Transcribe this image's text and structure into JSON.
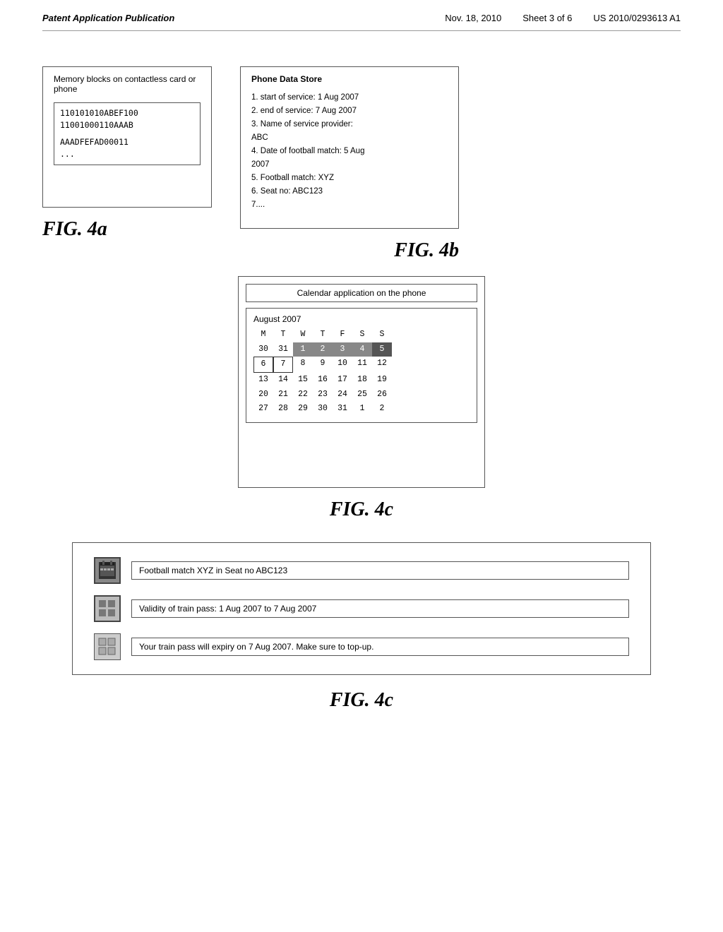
{
  "header": {
    "pub_type": "Patent Application Publication",
    "date": "Nov. 18, 2010",
    "sheet": "Sheet 3",
    "of_pages": "of 6",
    "patent_number": "US 2010/0293613 A1"
  },
  "fig4a": {
    "label": "FIG. 4a",
    "box_title": "Memory blocks on contactless card or phone",
    "memory_lines": [
      "110101010ABEF100",
      "11001000110AAAB",
      "",
      "AAADFEFAD00011",
      "..."
    ]
  },
  "fig4b": {
    "label": "FIG. 4b",
    "box_title": "Phone Data Store",
    "items": [
      "1. start of service: 1 Aug 2007",
      "2. end of service: 7 Aug 2007",
      "3. Name of service provider: ABC",
      "4. Date of football match: 5 Aug 2007",
      "5. Football match: XYZ",
      "6. Seat no: ABC123",
      "7...."
    ]
  },
  "fig4c_calendar": {
    "label": "FIG. 4c",
    "header_text": "Calendar application on the phone",
    "month_title": "August 2007",
    "day_headers": [
      "M",
      "T",
      "W",
      "T",
      "F",
      "S",
      "S"
    ],
    "weeks": [
      [
        "30",
        "31",
        "1",
        "2",
        "3",
        "4",
        "5"
      ],
      [
        "6",
        "7",
        "8",
        "9",
        "10",
        "11",
        "12"
      ],
      [
        "13",
        "14",
        "15",
        "16",
        "17",
        "18",
        "19"
      ],
      [
        "20",
        "21",
        "22",
        "23",
        "24",
        "25",
        "26"
      ],
      [
        "27",
        "28",
        "29",
        "30",
        "31",
        "1",
        "2"
      ]
    ],
    "highlighted_cells": [
      "1",
      "2",
      "3",
      "4",
      "5",
      "6",
      "7"
    ],
    "week1_highlight": [
      2,
      3,
      4,
      5,
      6
    ],
    "week2_highlight": [
      0,
      1
    ]
  },
  "fig4c_notifications": {
    "label": "FIG. 4c",
    "notifications": [
      {
        "id": "notif-1",
        "icon_type": "calendar-dark",
        "text": "Football match XYZ in Seat no ABC123"
      },
      {
        "id": "notif-2",
        "icon_type": "grid-medium",
        "text": "Validity of train pass: 1 Aug 2007 to 7 Aug 2007"
      },
      {
        "id": "notif-3",
        "icon_type": "grid-light",
        "text": "Your train pass will expiry on 7 Aug 2007. Make sure to top-up."
      }
    ]
  }
}
